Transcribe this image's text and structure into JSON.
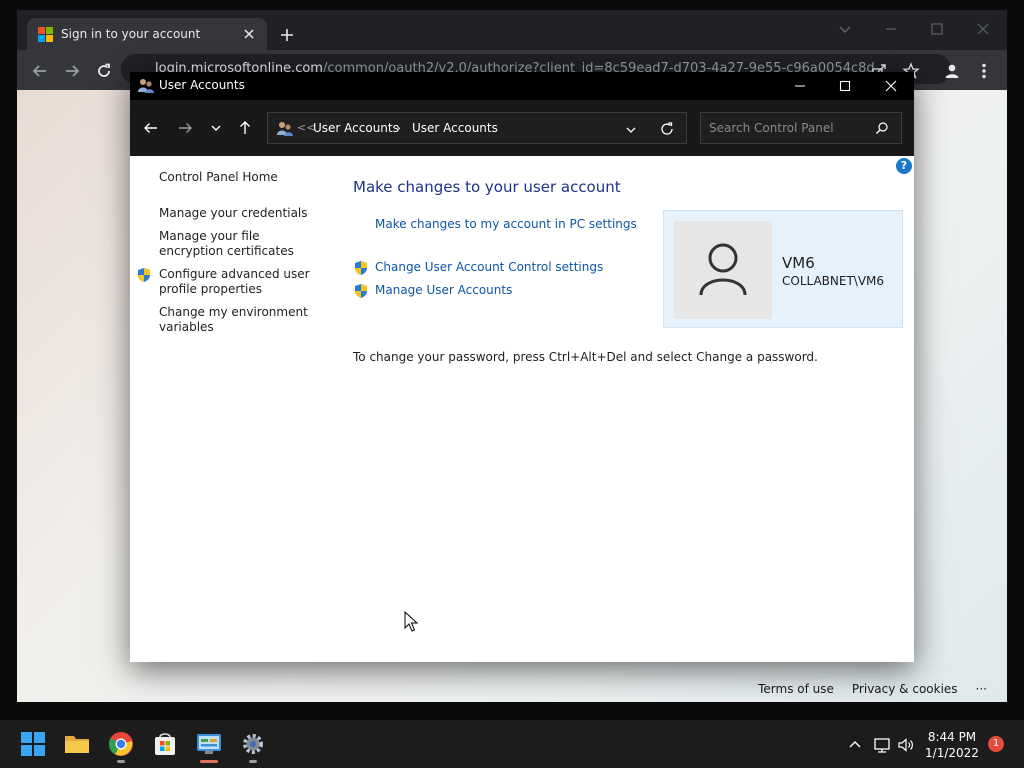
{
  "browser": {
    "tab_title": "Sign in to your account",
    "url_host": "login.microsoftonline.com",
    "url_path": "/common/oauth2/v2.0/authorize?client_id=8c59ead7-d703-4a27-9e55-c96a0054c8d",
    "footer_terms": "Terms of use",
    "footer_privacy": "Privacy & cookies",
    "footer_more": "···"
  },
  "window": {
    "title": "User Accounts",
    "breadcrumb_sep": "<<",
    "breadcrumb": [
      "User Accounts",
      "User Accounts"
    ],
    "search_placeholder": "Search Control Panel",
    "help": "?"
  },
  "left_nav": {
    "items": [
      "Control Panel Home",
      "Manage your credentials",
      "Manage your file encryption certificates",
      "Configure advanced user profile properties",
      "Change my environment variables"
    ]
  },
  "main": {
    "heading": "Make changes to your user account",
    "links": [
      "Make changes to my account in PC settings",
      "Change User Account Control settings",
      "Manage User Accounts"
    ],
    "note": "To change your password, press Ctrl+Alt+Del and select Change a password."
  },
  "user": {
    "name": "VM6",
    "domain": "COLLABNET\\VM6"
  },
  "taskbar": {
    "time": "8:44 PM",
    "date": "1/1/2022",
    "notification_count": "1"
  },
  "colors": {
    "link": "#0d56a6",
    "heading": "#1e3287",
    "card_bg": "#e5f1fb",
    "titlebar": "#000000",
    "accent": "#1979ca"
  }
}
